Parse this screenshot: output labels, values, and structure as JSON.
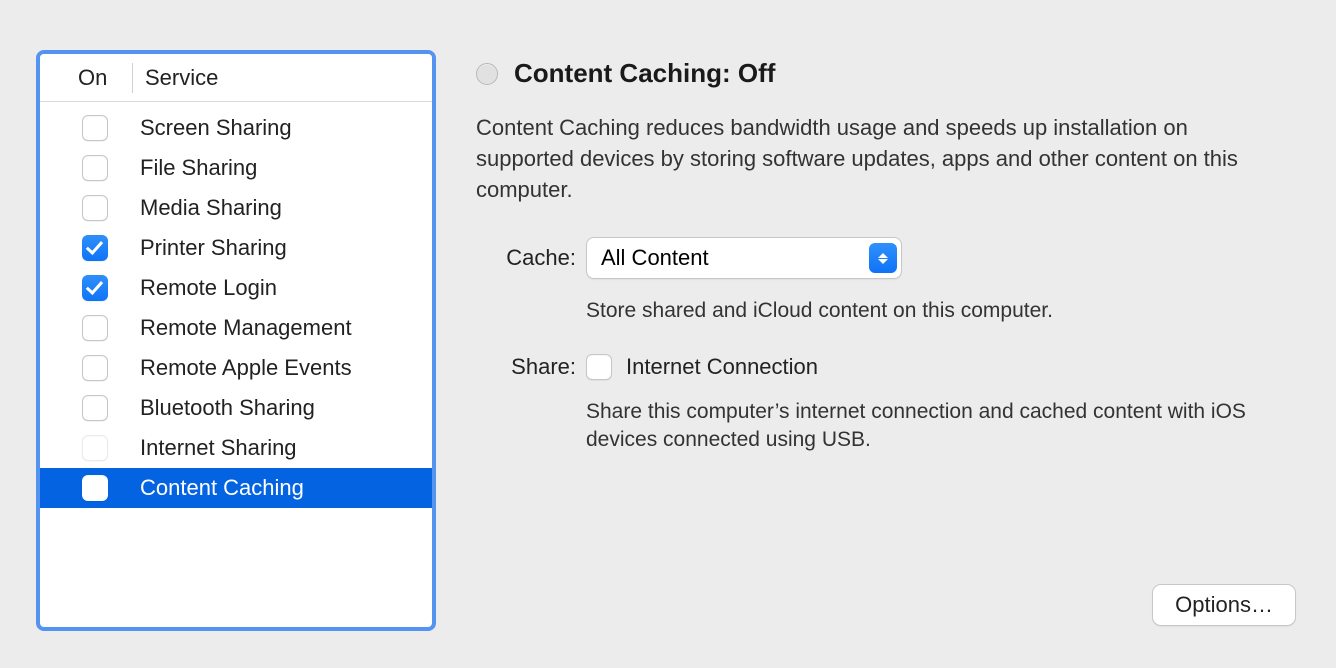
{
  "sidebar": {
    "header_on": "On",
    "header_service": "Service",
    "services": [
      {
        "label": "Screen Sharing",
        "checked": false,
        "selected": false
      },
      {
        "label": "File Sharing",
        "checked": false,
        "selected": false
      },
      {
        "label": "Media Sharing",
        "checked": false,
        "selected": false
      },
      {
        "label": "Printer Sharing",
        "checked": true,
        "selected": false
      },
      {
        "label": "Remote Login",
        "checked": true,
        "selected": false
      },
      {
        "label": "Remote Management",
        "checked": false,
        "selected": false
      },
      {
        "label": "Remote Apple Events",
        "checked": false,
        "selected": false
      },
      {
        "label": "Bluetooth Sharing",
        "checked": false,
        "selected": false
      },
      {
        "label": "Internet Sharing",
        "checked": false,
        "selected": false,
        "disabled": true
      },
      {
        "label": "Content Caching",
        "checked": false,
        "selected": true
      }
    ]
  },
  "detail": {
    "status_title": "Content Caching: Off",
    "description": "Content Caching reduces bandwidth usage and speeds up installation on supported devices by storing software updates, apps and other content on this computer.",
    "cache_label": "Cache:",
    "cache_value": "All Content",
    "cache_help": "Store shared and iCloud content on this computer.",
    "share_label": "Share:",
    "share_option": "Internet Connection",
    "share_help": "Share this computer’s internet connection and cached content with iOS devices connected using USB."
  },
  "buttons": {
    "options": "Options…"
  }
}
